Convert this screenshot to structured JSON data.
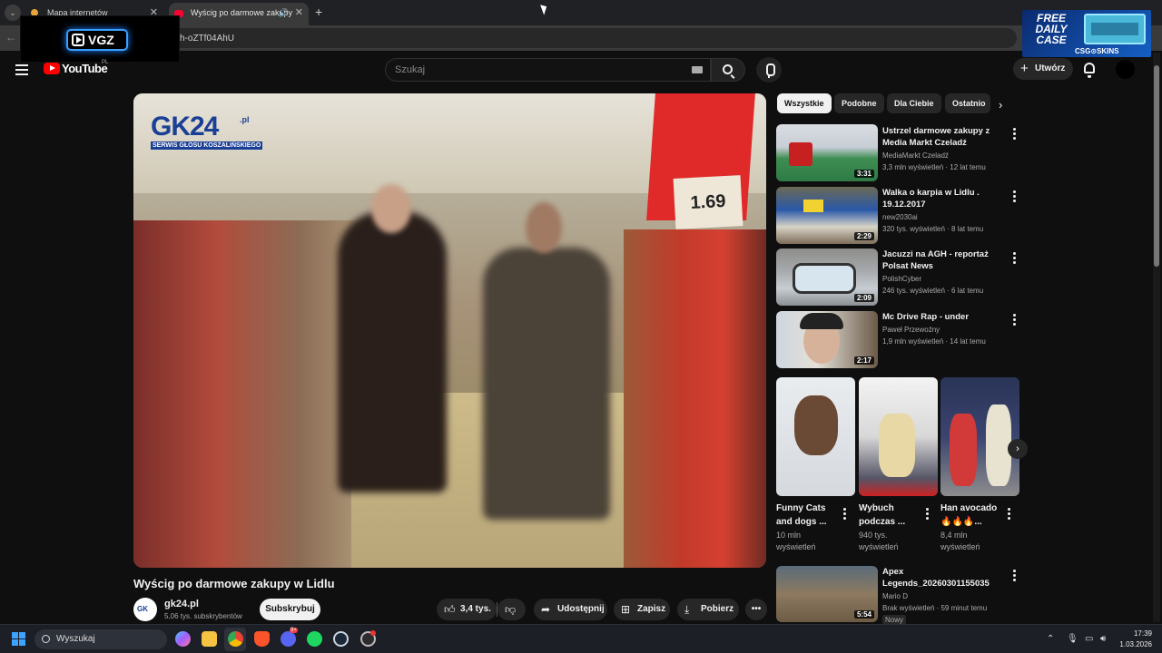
{
  "browser": {
    "tabs": [
      {
        "title": "Mapa internetów",
        "icon": "map-pin-icon"
      },
      {
        "title": "Wyścig po darmowe zakupy",
        "icon": "youtube-icon",
        "audio": true
      }
    ],
    "url_fragment": "h-oZTf04AhU",
    "overlay_logo": "VGZ"
  },
  "ad": {
    "line1": "FREE",
    "line2": "DAILY",
    "line3": "CASE",
    "brand": "CSG⊙SKINS"
  },
  "header": {
    "logo_text": "YouTube",
    "region": "PL",
    "search_placeholder": "Szukaj",
    "create_label": "Utwórz"
  },
  "video": {
    "title": "Wyścig po darmowe zakupy w Lidlu",
    "overlay_logo": "GK24",
    "overlay_logo_suffix": ".pl",
    "overlay_logo_sub": "SERWIS GŁOSU KOSZALIŃSKIEGO",
    "price_tag": "1.69",
    "channel": {
      "name": "gk24.pl",
      "subscribers": "5,06 tys. subskrybentów",
      "subscribe_label": "Subskrybuj"
    },
    "actions": {
      "likes": "3,4 tys.",
      "share": "Udostępnij",
      "save": "Zapisz",
      "download": "Pobierz"
    }
  },
  "chips": [
    "Wszystkie",
    "Podobne",
    "Dla Ciebie",
    "Ostatnio"
  ],
  "recommendations": [
    {
      "title": "Ustrzel darmowe zakupy z Media Markt Czeladź",
      "channel": "MediaMarkt Czeladź",
      "stats": "3,3 mln wyświetleń · 12 lat temu",
      "duration": "3:31"
    },
    {
      "title": "Walka o karpia w Lidlu . 19.12.2017",
      "channel": "new2030ai",
      "stats": "320 tys. wyświetleń · 8 lat temu",
      "duration": "2:29"
    },
    {
      "title": "Jacuzzi na AGH - reportaż Polsat News",
      "channel": "PolishCyber",
      "stats": "246 tys. wyświetleń · 6 lat temu",
      "duration": "2:09"
    },
    {
      "title": "Mc Drive Rap - under",
      "channel": "Paweł Przewoźny",
      "stats": "1,9 mln wyświetleń · 14 lat temu",
      "duration": "2:17"
    }
  ],
  "shorts": [
    {
      "title_l1": "Funny Cats",
      "title_l2": "and dogs ...",
      "views_l1": "10 mln",
      "views_l2": "wyświetleń"
    },
    {
      "title_l1": "Wybuch",
      "title_l2": "podczas ...",
      "views_l1": "940 tys.",
      "views_l2": "wyświetleń"
    },
    {
      "title_l1": "Han avocado",
      "title_l2": "🔥🔥🔥...",
      "views_l1": "8,4 mln",
      "views_l2": "wyświetleń"
    }
  ],
  "last_rec": {
    "title": "Apex Legends_20260301155035",
    "channel": "Mario D",
    "stats": "Brak wyświetleń · 59 minut temu",
    "duration": "5:54",
    "badge": "Nowy"
  },
  "taskbar": {
    "search_placeholder": "Wyszukaj",
    "time": "17:39",
    "date": "1.03.2026",
    "discord_badge": "9+"
  }
}
